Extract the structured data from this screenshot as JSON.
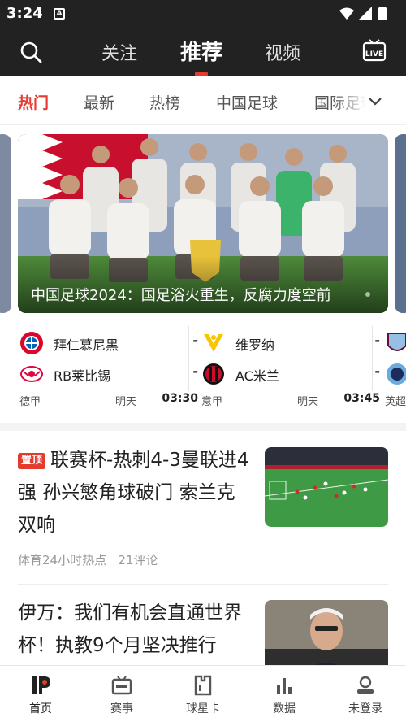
{
  "status_bar": {
    "time": "3:24",
    "notification_letter": "A"
  },
  "header": {
    "tabs": [
      {
        "label": "关注"
      },
      {
        "label": "推荐"
      },
      {
        "label": "视频"
      }
    ],
    "active_tab": "推荐",
    "live_label": "LIVE"
  },
  "categories": {
    "items": [
      {
        "label": "热门"
      },
      {
        "label": "最新"
      },
      {
        "label": "热榜"
      },
      {
        "label": "中国足球"
      },
      {
        "label": "国际足球"
      }
    ],
    "active": "热门"
  },
  "banner": {
    "caption": "中国足球2024：国足浴火重生，反腐力度空前"
  },
  "matches": [
    {
      "home": {
        "name": "拜仁慕尼黑",
        "score": "-"
      },
      "away": {
        "name": "RB莱比锡",
        "score": "-"
      },
      "league": "德甲",
      "day": "明天",
      "time": "03:30"
    },
    {
      "home": {
        "name": "维罗纳",
        "score": "-"
      },
      "away": {
        "name": "AC米兰",
        "score": "-"
      },
      "league": "意甲",
      "day": "明天",
      "time": "03:45"
    },
    {
      "league": "英超"
    }
  ],
  "news": [
    {
      "pinned": true,
      "pin_label": "置顶",
      "title": "联赛杯-热刺4-3曼联进4强 孙兴慜角球破门 索兰克双响",
      "source": "体育24小时热点",
      "comments": "21评论"
    },
    {
      "pinned": false,
      "title": "伊万：我们有机会直通世界杯！执教9个月坚决推行"
    }
  ],
  "bottom_nav": {
    "items": [
      {
        "label": "首页",
        "icon": "home-logo-icon"
      },
      {
        "label": "赛事",
        "icon": "tv-icon"
      },
      {
        "label": "球星卡",
        "icon": "card-icon"
      },
      {
        "label": "数据",
        "icon": "bar-chart-icon"
      },
      {
        "label": "未登录",
        "icon": "user-icon"
      }
    ],
    "active": "首页"
  },
  "colors": {
    "accent": "#e53a2e",
    "header_bg": "#222222"
  }
}
